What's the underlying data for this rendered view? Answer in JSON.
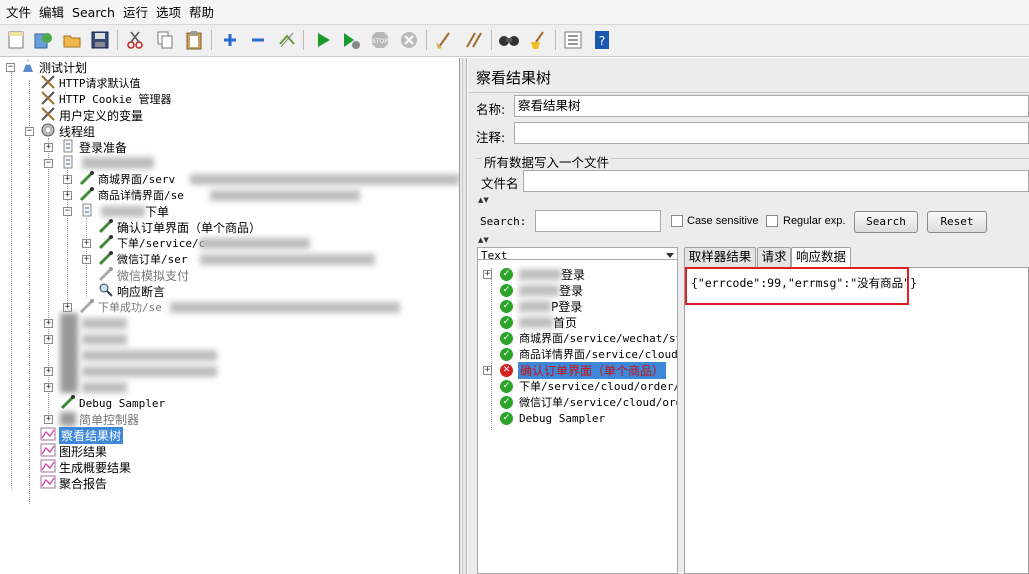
{
  "menubar": {
    "items": [
      "文件",
      "编辑",
      "Search",
      "运行",
      "选项",
      "帮助"
    ]
  },
  "toolbar": {
    "icons": [
      "new-icon",
      "templates-icon",
      "open-icon",
      "save-icon",
      "cut-icon",
      "copy-icon",
      "paste-icon",
      "expand-icon",
      "collapse-icon",
      "toggle-icon",
      "start-icon",
      "start-no-pause-icon",
      "stop-icon",
      "shutdown-icon",
      "clear-icon",
      "clear-all-icon",
      "search-icon",
      "reset-search-icon",
      "function-helper-icon",
      "help-icon"
    ]
  },
  "tree": {
    "root": "测试计划",
    "http_defaults": "HTTP请求默认值",
    "cookie_manager": "HTTP Cookie 管理器",
    "user_vars": "用户定义的变量",
    "thread_group": "线程组",
    "login_prep": "登录准备",
    "mall_page": "商城界面/serv",
    "product_detail": "商品详情界面/se",
    "order_controller_suffix": "下单",
    "confirm_order": "确认订单界面（单个商品）",
    "order_submit": "下单/service/c",
    "wechat_order": "微信订单/ser",
    "wechat_pay": "微信模拟支付",
    "response_assert": "响应断言",
    "order_success": "下单成功/se",
    "debug_sampler": "Debug Sampler",
    "simple_controller": "简单控制器",
    "view_results_tree": "察看结果树",
    "graph_results": "图形结果",
    "summary_report": "生成概要结果",
    "aggregate_report": "聚合报告"
  },
  "panel": {
    "title": "察看结果树",
    "name_label": "名称:",
    "name_value": "察看结果树",
    "comment_label": "注释:",
    "comment_value": "",
    "file_group_title": "所有数据写入一个文件",
    "filename_label": "文件名",
    "filename_value": "",
    "search_label": "Search:",
    "search_value": "",
    "case_sensitive": "Case sensitive",
    "regular_exp": "Regular exp.",
    "search_button": "Search",
    "reset_button": "Reset",
    "renderer": "Text"
  },
  "results": {
    "items": [
      {
        "label": "登录",
        "status": "ok"
      },
      {
        "label": "登录",
        "status": "ok"
      },
      {
        "label": "P登录",
        "status": "ok"
      },
      {
        "label": "首页",
        "status": "ok"
      },
      {
        "label": "商城界面/service/wechat/st",
        "status": "ok"
      },
      {
        "label": "商品详情界面/service/cloud",
        "status": "ok"
      },
      {
        "label": "确认订单界面（单个商品）",
        "status": "error"
      },
      {
        "label": "下单/service/cloud/order/c",
        "status": "ok"
      },
      {
        "label": "微信订单/service/cloud/ord",
        "status": "ok"
      },
      {
        "label": "Debug Sampler",
        "status": "ok"
      }
    ]
  },
  "tabs": {
    "sampler_result": "取样器结果",
    "request": "请求",
    "response_data": "响应数据"
  },
  "response": {
    "body": "{\"errcode\":99,\"errmsg\":\"没有商品\"}"
  }
}
